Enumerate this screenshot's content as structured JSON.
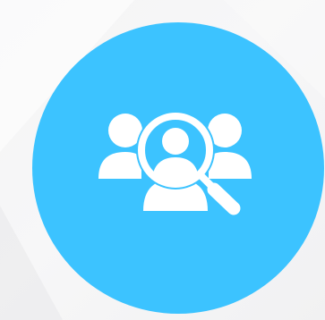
{
  "badge": {
    "color": "#3cc3ff",
    "icon": "people-search-icon"
  },
  "background": {
    "color": "#f4f4f5",
    "accent": "#ffffff"
  }
}
